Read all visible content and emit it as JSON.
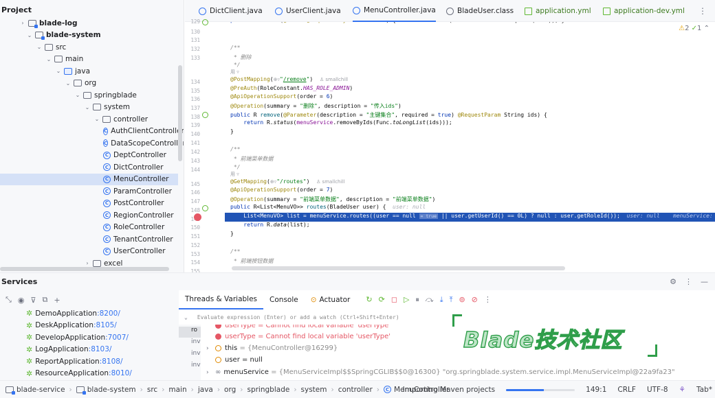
{
  "project": {
    "title": "Project",
    "tree": [
      {
        "label": "blade-log",
        "type": "module",
        "chev": "›",
        "bold": true
      },
      {
        "label": "blade-system",
        "type": "module",
        "chev": "⌄",
        "bold": true
      },
      {
        "label": "src",
        "type": "folder",
        "chev": "⌄"
      },
      {
        "label": "main",
        "type": "folder",
        "chev": "⌄"
      },
      {
        "label": "java",
        "type": "folder",
        "chev": "⌄"
      },
      {
        "label": "org",
        "type": "folder",
        "chev": "⌄"
      },
      {
        "label": "springblade",
        "type": "folder",
        "chev": "⌄"
      },
      {
        "label": "system",
        "type": "folder",
        "chev": "⌄"
      },
      {
        "label": "controller",
        "type": "folder",
        "chev": "⌄"
      },
      {
        "label": "AuthClientController",
        "type": "class"
      },
      {
        "label": "DataScopeController",
        "type": "class"
      },
      {
        "label": "DeptController",
        "type": "class"
      },
      {
        "label": "DictController",
        "type": "class"
      },
      {
        "label": "MenuController",
        "type": "class",
        "selected": true
      },
      {
        "label": "ParamController",
        "type": "class"
      },
      {
        "label": "PostController",
        "type": "class"
      },
      {
        "label": "RegionController",
        "type": "class"
      },
      {
        "label": "RoleController",
        "type": "class"
      },
      {
        "label": "TenantController",
        "type": "class"
      },
      {
        "label": "UserController",
        "type": "class"
      },
      {
        "label": "excel",
        "type": "folder",
        "chev": "›"
      }
    ]
  },
  "tabs": [
    {
      "label": "DictClient.java",
      "type": "java"
    },
    {
      "label": "UserClient.java",
      "type": "java"
    },
    {
      "label": "MenuController.java",
      "type": "java",
      "active": true
    },
    {
      "label": "BladeUser.class",
      "type": "class"
    },
    {
      "label": "application.yml",
      "type": "yml"
    },
    {
      "label": "application-dev.yml",
      "type": "yml"
    }
  ],
  "tabs_more": "⋮",
  "inspections": {
    "warnings": "2",
    "checks": "1"
  },
  "code": {
    "line_numbers": [
      "129",
      "130",
      "131",
      "132",
      "133",
      "",
      "134",
      "135",
      "136",
      "137",
      "138",
      "139",
      "140",
      "141",
      "142",
      "143",
      "144",
      "",
      "145",
      "146",
      "147",
      "148",
      "149",
      "150",
      "151",
      "152",
      "153",
      "154",
      "155"
    ],
    "author_hint": "smallchill",
    "usage_hint": "用 ▿",
    "comment_delete": "删除",
    "comment_routes": "前端菜单数据",
    "comment_buttons": "前端按钮数据",
    "remove_path": "/remove",
    "routes_path": "/routes",
    "remove_summary": "删除",
    "remove_notes": "传入ids",
    "remove_param_desc": "主键集合",
    "routes_summary": "前端菜单数据",
    "routes_notes": "前端菜单数据",
    "role_const": "HAS_ROLE_ADMIN",
    "order_remove": "6",
    "order_routes": "7",
    "user_hint": "user: null",
    "hl_hint": "user: null    menuService: \"",
    "null_chip": "= true"
  },
  "services": {
    "title": "Services",
    "apps": [
      {
        "name": "DemoApplication",
        "port": ":8200/"
      },
      {
        "name": "DeskApplication",
        "port": ":8105/"
      },
      {
        "name": "DevelopApplication",
        "port": ":7007/"
      },
      {
        "name": "LogApplication",
        "port": ":8103/"
      },
      {
        "name": "ReportApplication",
        "port": ":8108/"
      },
      {
        "name": "ResourceApplication",
        "port": ":8010/"
      }
    ]
  },
  "debug": {
    "tabs": [
      "Threads & Variables",
      "Console",
      "Actuator"
    ],
    "eval_placeholder": "Evaluate expression (Enter) or add a watch (Ctrl+Shift+Enter)",
    "frames": [
      "ro",
      "inv",
      "inv",
      "inv"
    ],
    "vars": [
      {
        "name": "userType",
        "value": "= Cannot find local variable 'userType'",
        "icon": "red",
        "error": true
      },
      {
        "name": "userType",
        "value": "= Cannot find local variable 'userType'",
        "icon": "red",
        "error": true
      },
      {
        "name": "this",
        "value": "= {MenuController@16299}",
        "icon": "orange",
        "expand": true
      },
      {
        "name": "user",
        "value": "= null",
        "icon": "orange"
      },
      {
        "name": "menuService",
        "value": "= {MenuServiceImpl$$SpringCGLIB$$0@16300} \"org.springblade.system.service.impl.MenuServiceImpl@22a9fa23\"",
        "icon": "glasses",
        "expand": true
      }
    ]
  },
  "watermark": "Blade技术社区",
  "status": {
    "breadcrumbs": [
      "blade-service",
      "blade-system",
      "src",
      "main",
      "java",
      "org",
      "springblade",
      "system",
      "controller",
      "MenuController"
    ],
    "task": "Importing Maven projects",
    "progress": 0.55,
    "position": "149:1",
    "line_ending": "CRLF",
    "encoding": "UTF-8",
    "indent": "Tab*"
  }
}
